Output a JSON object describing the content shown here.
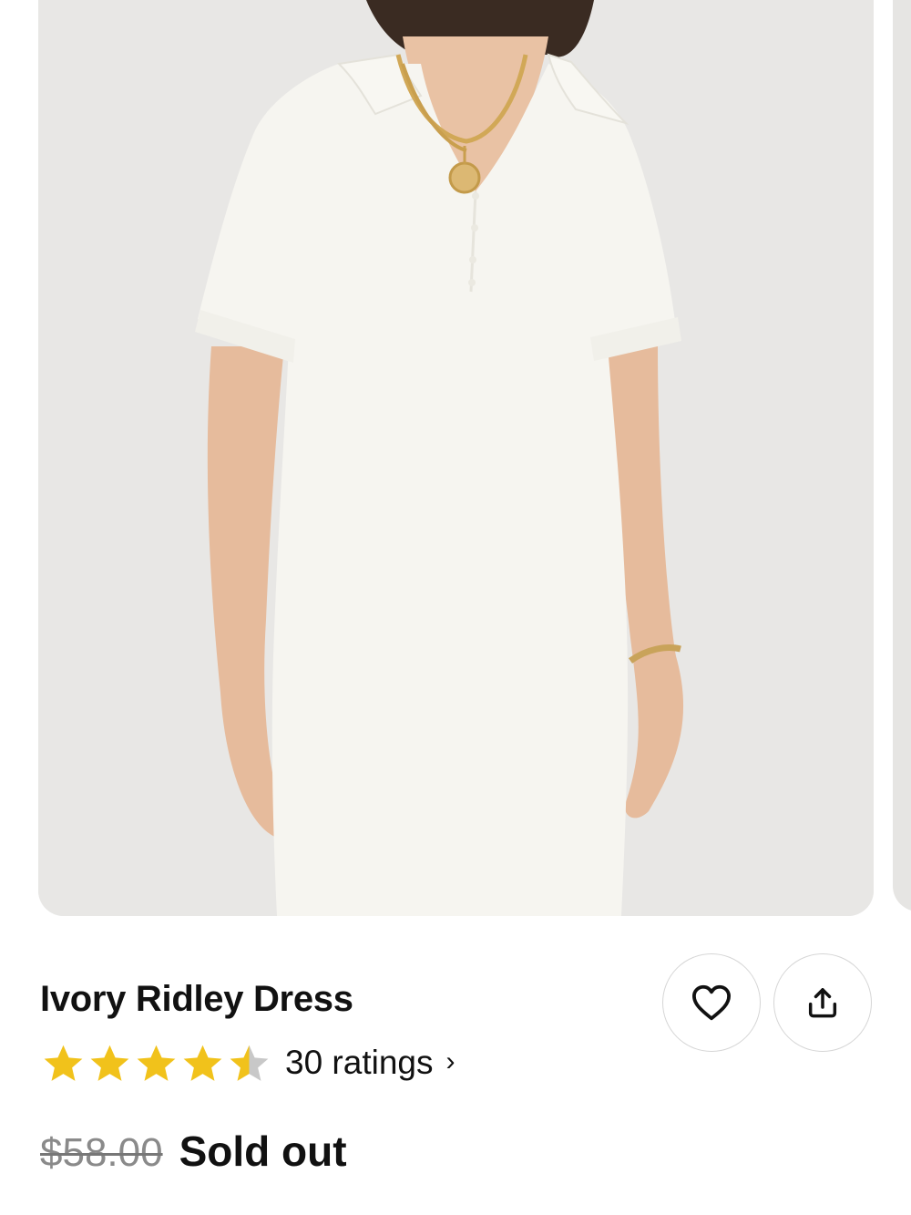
{
  "product": {
    "title": "Ivory Ridley Dress",
    "rating": 4.5,
    "rating_max": 5,
    "ratings_text": "30 ratings",
    "ratings_chevron": "›",
    "original_price": "$58.00",
    "status": "Sold out"
  },
  "gallery": {
    "image_subject": "model wearing ivory short-sleeve polo knit dress with gold necklaces",
    "background_color": "#e7e6e4"
  },
  "actions": {
    "favorite_icon": "heart-icon",
    "share_icon": "share-upload-icon"
  },
  "colors": {
    "star_filled": "#F1C21B",
    "star_empty": "#C8C8C8",
    "text_primary": "#111111",
    "text_muted": "#8A8A8A"
  }
}
